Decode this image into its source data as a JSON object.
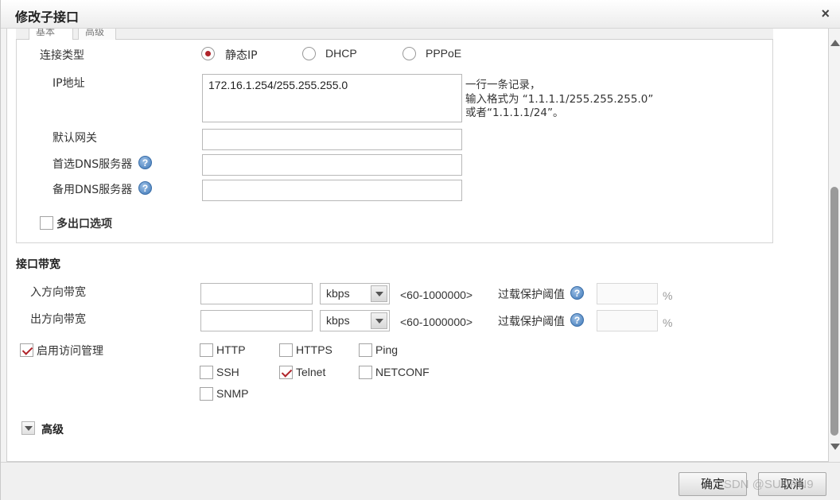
{
  "dialog": {
    "title": "修改子接口",
    "close_label": "×"
  },
  "tabs": [
    {
      "label": "基本"
    },
    {
      "label": "高级"
    }
  ],
  "connection": {
    "type_label": "连接类型",
    "options": [
      {
        "label": "静态IP",
        "selected": true
      },
      {
        "label": "DHCP",
        "selected": false
      },
      {
        "label": "PPPoE",
        "selected": false
      }
    ],
    "ip_label": "IP地址",
    "ip_value": "172.16.1.254/255.255.255.0",
    "ip_hint": [
      "一行一条记录，",
      "输入格式为 “1.1.1.1/255.255.255.0”",
      "或者“1.1.1.1/24”。"
    ],
    "gateway_label": "默认网关",
    "gateway_value": "",
    "dns1_label": "首选DNS服务器",
    "dns1_value": "",
    "dns2_label": "备用DNS服务器",
    "dns2_value": "",
    "help_glyph": "?",
    "multi_exit_label": "多出口选项",
    "multi_exit_checked": false
  },
  "bandwidth": {
    "title": "接口带宽",
    "in_label": "入方向带宽",
    "out_label": "出方向带宽",
    "in_value": "",
    "out_value": "",
    "unit": "kbps",
    "range": "<60-1000000>",
    "overload_label": "过载保护阈值",
    "overload_in": "",
    "overload_out": "",
    "percent": "%"
  },
  "access": {
    "label": "启用访问管理",
    "enabled": true,
    "services": [
      {
        "label": "HTTP",
        "checked": false
      },
      {
        "label": "HTTPS",
        "checked": false
      },
      {
        "label": "Ping",
        "checked": false
      },
      {
        "label": "SSH",
        "checked": false
      },
      {
        "label": "Telnet",
        "checked": true
      },
      {
        "label": "NETCONF",
        "checked": false
      },
      {
        "label": "SNMP",
        "checked": false
      }
    ]
  },
  "advanced": {
    "label": "高级"
  },
  "buttons": {
    "ok": "确定",
    "cancel": "取消"
  },
  "watermark": "CSDN @SUNRN9",
  "colors": {
    "accent": "#b0242a",
    "help_icon": "#3e78b8"
  }
}
